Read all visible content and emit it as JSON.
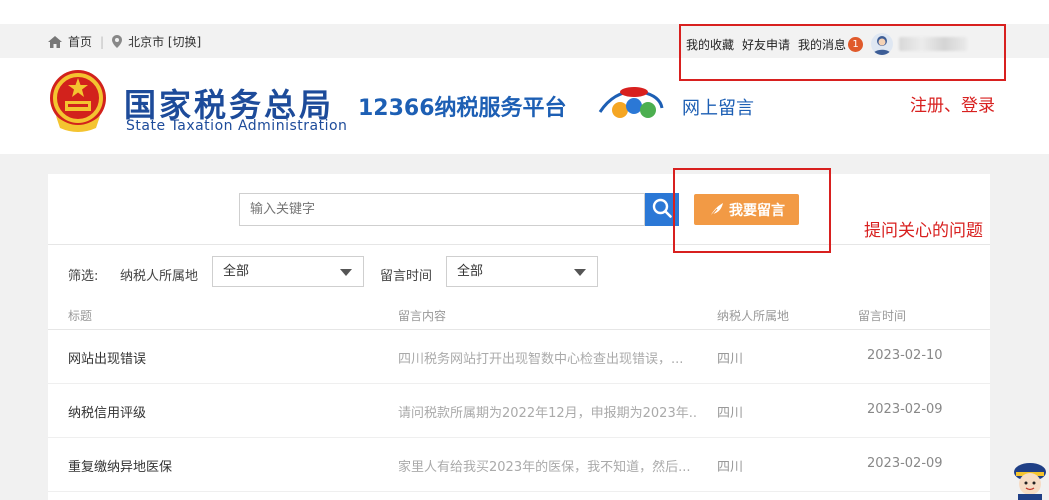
{
  "topbar": {
    "home_label": "首页",
    "city_label": "北京市 [切换]",
    "favorites_label": "我的收藏",
    "friend_requests_label": "好友申请",
    "messages_label": "我的消息",
    "messages_badge": "1"
  },
  "header": {
    "title_cn": "国家税务总局",
    "title_en": "State Taxation Administration",
    "service_title": "12366纳税服务平台",
    "online_message_label": "网上留言"
  },
  "annotations": {
    "login_note": "注册、登录",
    "ask_note": "提问关心的问题"
  },
  "search": {
    "placeholder": "输入关键字",
    "post_button_label": "我要留言"
  },
  "filters": {
    "label": "筛选:",
    "region_label": "纳税人所属地",
    "region_value": "全部",
    "time_label": "留言时间",
    "time_value": "全部"
  },
  "table": {
    "columns": [
      "标题",
      "留言内容",
      "纳税人所属地",
      "留言时间"
    ],
    "rows": [
      {
        "title": "网站出现错误",
        "content": "四川税务网站打开出现智数中心检查出现错误，...",
        "region": "四川",
        "time": "2023-02-10"
      },
      {
        "title": "纳税信用评级",
        "content": "请问税款所属期为2022年12月，申报期为2023年..",
        "region": "四川",
        "time": "2023-02-09"
      },
      {
        "title": "重复缴纳异地医保",
        "content": "家里人有给我买2023年的医保，我不知道，然后...",
        "region": "四川",
        "time": "2023-02-09"
      }
    ]
  },
  "colors": {
    "brand_blue": "#1d4b9a",
    "search_blue": "#2b78d6",
    "post_orange": "#f29a45",
    "annotation_red": "#d8201f",
    "badge_orange": "#e05a2b"
  }
}
